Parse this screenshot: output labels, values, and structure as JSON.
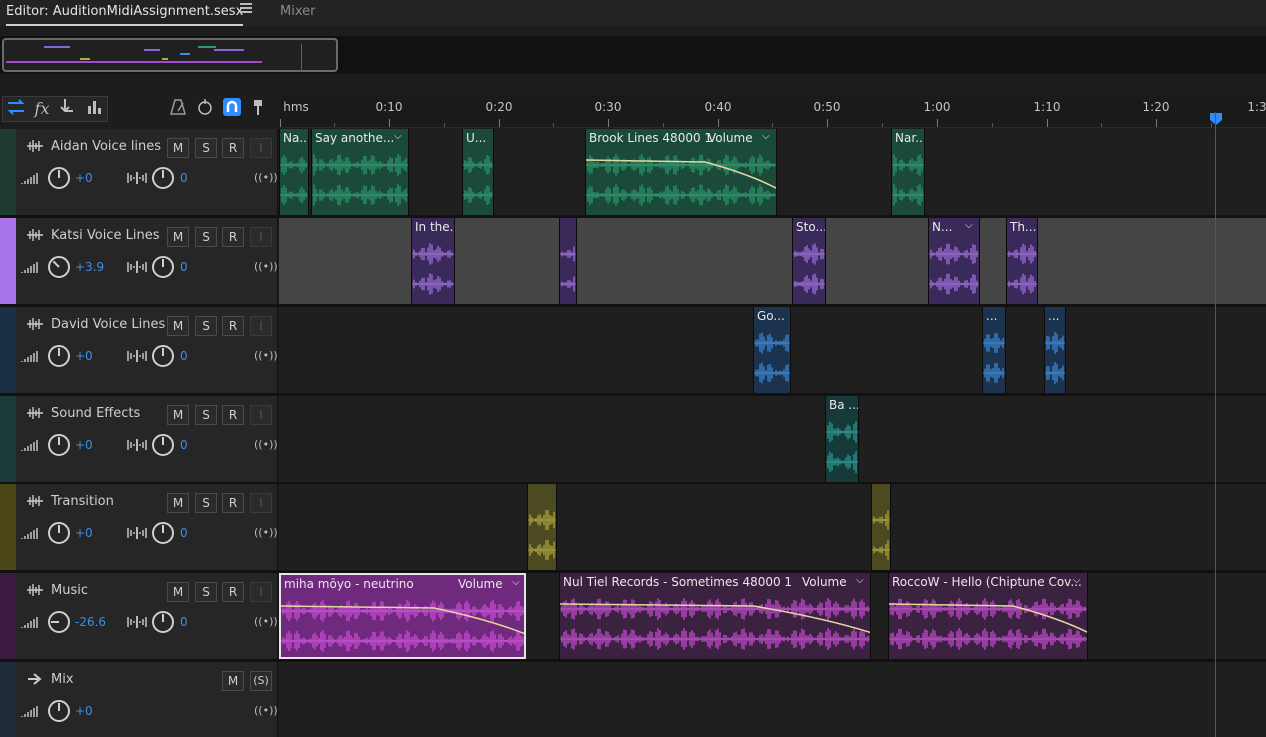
{
  "tabs": {
    "editor_label": "Editor: AuditionMidiAssignment.sesx",
    "mixer_label": "Mixer"
  },
  "toolbar": {
    "icons": [
      "switch-icon",
      "fx-icon",
      "send-icon",
      "eq-icon",
      "metronome-icon",
      "loop-icon",
      "snap-icon",
      "marker-icon"
    ],
    "fx_label": "fx"
  },
  "ruler": {
    "unit_label": "hms",
    "ticks": [
      "0:10",
      "0:20",
      "0:30",
      "0:40",
      "0:50",
      "1:00",
      "1:10",
      "1:20",
      "1:3"
    ]
  },
  "colors": {
    "accent": "#2e8cff",
    "aidan": "#2a9c6f",
    "katsi": "#a773e8",
    "david": "#3c8fe0",
    "sfx": "#29a39a",
    "transition": "#b7aa3a",
    "music": "#d24ee0",
    "playhead": "#c0272f"
  },
  "buttons": {
    "mute": "M",
    "solo": "S",
    "record": "R",
    "input": "I",
    "solo_mix": "(S)"
  },
  "tracks": [
    {
      "name": "Aidan Voice lines",
      "volume": "+0",
      "pan": "0",
      "output": "((•))",
      "clips": [
        {
          "title": "Na..."
        },
        {
          "title": "Say anothe..."
        },
        {
          "title": "U..."
        },
        {
          "title": "Brook Lines 48000 1",
          "volume_label": "Volume"
        },
        {
          "title": "Nar..."
        }
      ]
    },
    {
      "name": "Katsi Voice Lines",
      "volume": "+3.9",
      "pan": "0",
      "output": "((•))",
      "clips": [
        {
          "title": "In the..."
        },
        {
          "title": ""
        },
        {
          "title": "Sto..."
        },
        {
          "title": "N..."
        },
        {
          "title": "Th..."
        }
      ]
    },
    {
      "name": "David Voice Lines",
      "volume": "+0",
      "pan": "0",
      "output": "((•))",
      "clips": [
        {
          "title": "Go..."
        },
        {
          "title": "..."
        },
        {
          "title": "..."
        }
      ]
    },
    {
      "name": "Sound Effects",
      "volume": "+0",
      "pan": "0",
      "output": "((•))",
      "clips": [
        {
          "title": "Ba ..."
        }
      ]
    },
    {
      "name": "Transition",
      "volume": "+0",
      "pan": "0",
      "output": "((•))",
      "clips": [
        {
          "title": ""
        },
        {
          "title": ""
        }
      ]
    },
    {
      "name": "Music",
      "volume": "-26.6",
      "pan": "0",
      "output": "((•))",
      "clips": [
        {
          "title": "miha mōyo - neutrino",
          "volume_label": "Volume"
        },
        {
          "title": "Nul Tiel Records - Sometimes 48000 1",
          "volume_label": "Volume"
        },
        {
          "title": "RoccoW - Hello (Chiptune Cov..."
        }
      ]
    },
    {
      "name": "Mix",
      "volume": "+0",
      "output": "((•))"
    }
  ]
}
